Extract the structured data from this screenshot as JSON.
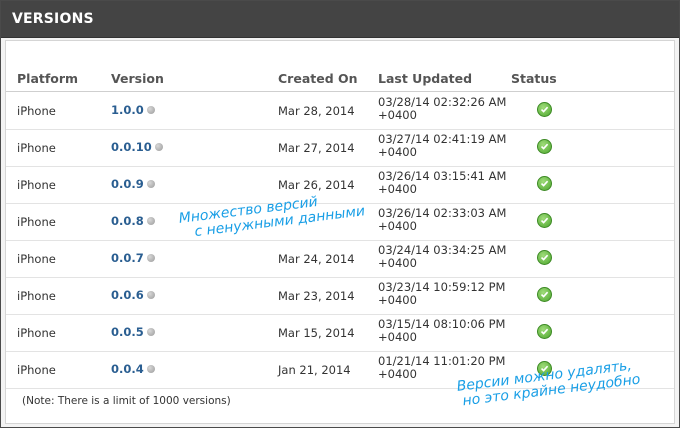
{
  "panel": {
    "title": "VERSIONS"
  },
  "table": {
    "headers": {
      "platform": "Platform",
      "version": "Version",
      "created": "Created On",
      "updated": "Last Updated",
      "status": "Status"
    },
    "rows": [
      {
        "platform": "iPhone",
        "version": "1.0.0",
        "created": "Mar 28, 2014",
        "updated_time": "03/28/14 02:32:26 AM",
        "updated_zone": "+0400",
        "status": "ok"
      },
      {
        "platform": "iPhone",
        "version": "0.0.10",
        "created": "Mar 27, 2014",
        "updated_time": "03/27/14 02:41:19 AM",
        "updated_zone": "+0400",
        "status": "ok"
      },
      {
        "platform": "iPhone",
        "version": "0.0.9",
        "created": "Mar 26, 2014",
        "updated_time": "03/26/14 03:15:41 AM",
        "updated_zone": "+0400",
        "status": "ok"
      },
      {
        "platform": "iPhone",
        "version": "0.0.8",
        "created": "",
        "updated_time": "03/26/14 02:33:03 AM",
        "updated_zone": "+0400",
        "status": "ok"
      },
      {
        "platform": "iPhone",
        "version": "0.0.7",
        "created": "Mar 24, 2014",
        "updated_time": "03/24/14 03:34:25 AM",
        "updated_zone": "+0400",
        "status": "ok"
      },
      {
        "platform": "iPhone",
        "version": "0.0.6",
        "created": "Mar 23, 2014",
        "updated_time": "03/23/14 10:59:12 PM",
        "updated_zone": "+0400",
        "status": "ok"
      },
      {
        "platform": "iPhone",
        "version": "0.0.5",
        "created": "Mar 15, 2014",
        "updated_time": "03/15/14 08:10:06 PM",
        "updated_zone": "+0400",
        "status": "ok"
      },
      {
        "platform": "iPhone",
        "version": "0.0.4",
        "created": "Jan 21, 2014",
        "updated_time": "01/21/14 11:01:20 PM",
        "updated_zone": "+0400",
        "status": "ok"
      }
    ]
  },
  "note": "(Note: There is a limit of 1000 versions)",
  "annotations": {
    "first_line1": "Множество версий",
    "first_line2": "с ненужными данными",
    "second_line1": "Версии можно удалять,",
    "second_line2": "но это крайне неудобно"
  },
  "colors": {
    "header_bg": "#444444",
    "link": "#2a5e91",
    "status_ok": "#4da62d",
    "annotation": "#1a9fe6"
  },
  "icons": {
    "version_info": "info-dot-icon",
    "status_ok": "check-circle-icon"
  }
}
